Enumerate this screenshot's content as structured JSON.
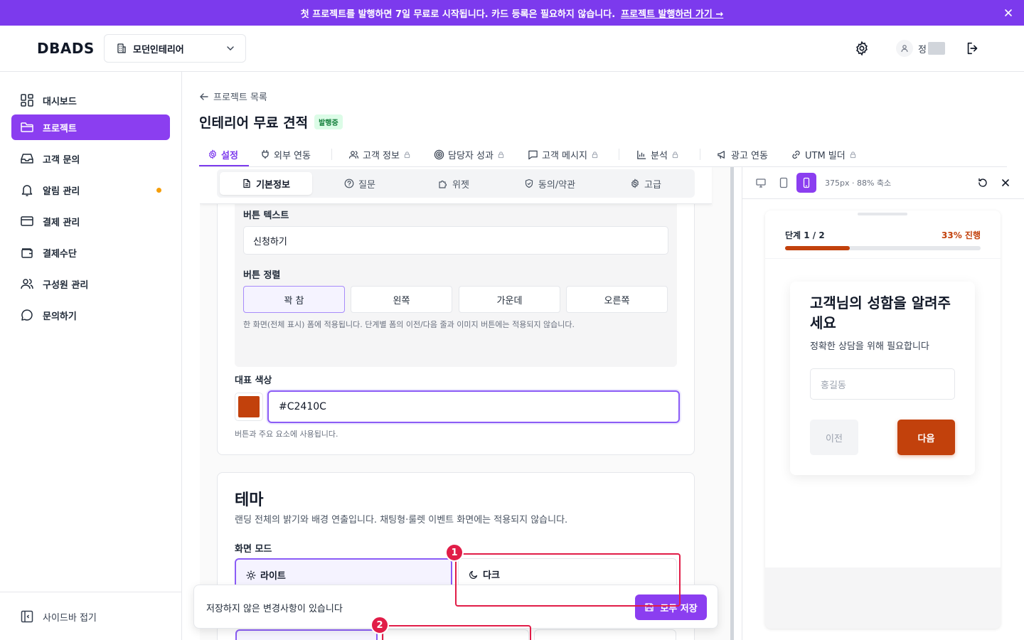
{
  "banner": {
    "text": "첫 프로젝트를 발행하면 7일 무료로 시작됩니다. 카드 등록은 필요하지 않습니다.",
    "link": "프로젝트 발행하러 가기 →"
  },
  "header": {
    "logo": "DBADS",
    "project": "모던인테리어",
    "user_initial": "정"
  },
  "sidebar": {
    "items": [
      {
        "label": "대시보드",
        "icon": "dashboard-icon"
      },
      {
        "label": "프로젝트",
        "icon": "folder-icon"
      },
      {
        "label": "고객 문의",
        "icon": "inbox-icon"
      },
      {
        "label": "알림 관리",
        "icon": "bell-icon"
      },
      {
        "label": "결제 관리",
        "icon": "card-icon"
      },
      {
        "label": "결제수단",
        "icon": "wallet-icon"
      },
      {
        "label": "구성원 관리",
        "icon": "users-icon"
      },
      {
        "label": "문의하기",
        "icon": "chat-icon"
      }
    ],
    "collapse": "사이드바 접기"
  },
  "main": {
    "back": "프로젝트 목록",
    "title": "인테리어 무료 견적",
    "status": "발행중",
    "tabs": [
      {
        "label": "설정"
      },
      {
        "label": "외부 연동"
      },
      {
        "label": "고객 정보"
      },
      {
        "label": "담당자 성과"
      },
      {
        "label": "고객 메시지"
      },
      {
        "label": "분석"
      },
      {
        "label": "광고 연동"
      },
      {
        "label": "UTM 빌더"
      }
    ]
  },
  "editor": {
    "subtabs": [
      "기본정보",
      "질문",
      "위젯",
      "동의/약관",
      "고급"
    ],
    "button_text_label": "버튼 텍스트",
    "button_text_value": "신청하기",
    "button_align_label": "버튼 정렬",
    "align_options": [
      "꽉 참",
      "왼쪽",
      "가운데",
      "오른쪽"
    ],
    "align_hint": "한 화면(전체 표시) 폼에 적용됩니다. 단계별 폼의 이전/다음 줄과 이미지 버튼에는 적용되지 않습니다.",
    "color_label": "대표 색상",
    "color_value": "#C2410C",
    "color_hint": "버튼과 주요 요소에 사용됩니다.",
    "theme_title": "테마",
    "theme_desc": "랜딩 전체의 밝기와 배경 연출입니다. 채팅형·룰렛 이벤트 화면에는 적용되지 않습니다.",
    "mode_label": "화면 모드",
    "modes": [
      "라이트",
      "다크"
    ]
  },
  "unsaved": {
    "message": "저장하지 않은 변경사항이 있습니다",
    "save_all": "모두 저장"
  },
  "annotations": [
    "1",
    "2"
  ],
  "preview": {
    "info": "375px · 88% 축소",
    "step": "단계 1 / 2",
    "percent": "33% 진행",
    "progress": 0.33,
    "question": "고객님의 성함을 알려주세요",
    "subtitle": "정확한 상담을 위해 필요합니다",
    "placeholder": "홍길동",
    "prev": "이전",
    "next": "다음"
  },
  "colors": {
    "accent": "#8b3ef0",
    "brand": "#C2410C",
    "annotation": "#e11d48"
  }
}
